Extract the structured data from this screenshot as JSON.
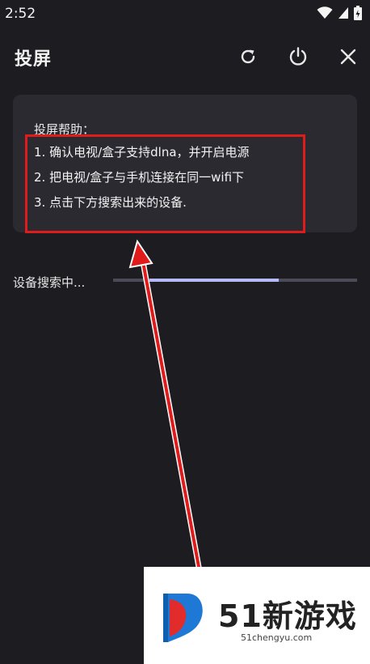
{
  "status_bar": {
    "time": "2:52",
    "icons": [
      "wifi-icon",
      "no-sim-icon",
      "battery-charging-icon"
    ]
  },
  "header": {
    "title": "投屏",
    "actions": [
      {
        "name": "refresh-icon"
      },
      {
        "name": "power-icon"
      },
      {
        "name": "close-icon"
      }
    ]
  },
  "help": {
    "title": "投屏帮助：",
    "steps": [
      "1. 确认电视/盒子支持dlna，并开启电源",
      "2. 把电视/盒子与手机连接在同一wifi下",
      "3. 点击下方搜索出来的设备."
    ]
  },
  "search": {
    "label": "设备搜索中...",
    "progress_fraction": 0.53
  },
  "colors": {
    "background": "#1c1c21",
    "card": "#2a2a30",
    "highlight": "#e01b1b",
    "progress_fill": "#b7b9ff",
    "progress_track": "#4a4a58"
  },
  "watermark": {
    "logo_text": "51新游戏",
    "site": "51chengyu.com"
  }
}
